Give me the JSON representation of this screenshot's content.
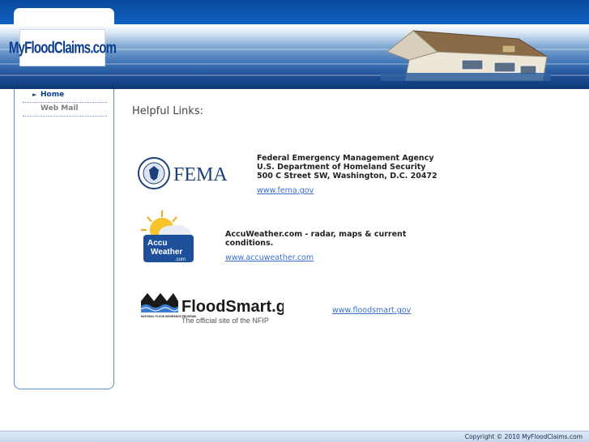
{
  "site": {
    "logo_text": "MyFloodClaims.com"
  },
  "nav": {
    "items": [
      {
        "label": "Home",
        "active": true
      },
      {
        "label": "Web Mail",
        "active": false
      }
    ]
  },
  "main": {
    "heading": "Helpful Links:",
    "links": [
      {
        "logo_label": "FEMA",
        "lines": [
          "Federal Emergency Management Agency",
          "U.S. Department of Homeland Security",
          "500 C Street SW, Washington, D.C. 20472"
        ],
        "url_text": "www.fema.gov"
      },
      {
        "logo_label": "AccuWeather.com",
        "lines": [
          "AccuWeather.com - radar, maps & current conditions."
        ],
        "url_text": "www.accuweather.com"
      },
      {
        "logo_label": "FloodSmart.gov",
        "logo_tagline": "The official site of the NFIP",
        "logo_program": "NATIONAL FLOOD INSURANCE PROGRAM",
        "url_text": "www.floodsmart.gov"
      }
    ]
  },
  "footer": {
    "copyright": "Copyright © 2010 MyFloodClaims.com"
  },
  "colors": {
    "brand_blue": "#0b3c8a",
    "link": "#3a6fc8",
    "border": "#5b8fd1"
  }
}
